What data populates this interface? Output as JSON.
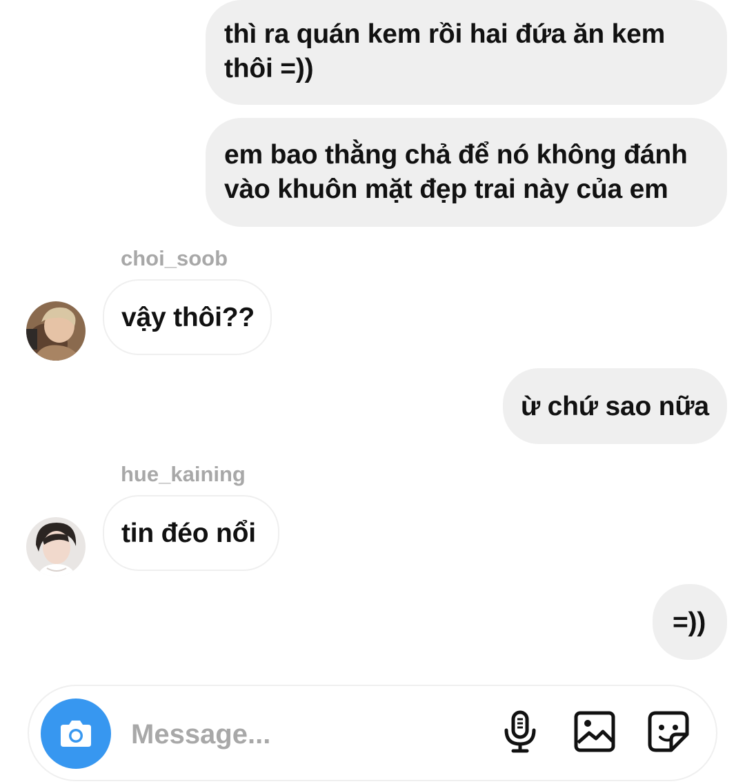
{
  "messages": [
    {
      "id": "m1",
      "direction": "outgoing",
      "lines": [
        "thì ra quán kem rồi hai đứa ăn kem",
        "thôi =))"
      ]
    },
    {
      "id": "m2",
      "direction": "outgoing",
      "lines": [
        "em bao thằng chả để nó không đánh",
        "vào khuôn mặt đẹp trai này của em"
      ]
    },
    {
      "id": "m3",
      "direction": "incoming",
      "sender": "choi_soob",
      "text": "vậy thôi??"
    },
    {
      "id": "m4",
      "direction": "outgoing",
      "text": "ừ chứ sao nữa"
    },
    {
      "id": "m5",
      "direction": "incoming",
      "sender": "hue_kaining",
      "text": "tin đéo nổi"
    },
    {
      "id": "m6",
      "direction": "outgoing",
      "text": "=))"
    }
  ],
  "composer": {
    "placeholder": "Message...",
    "icons": [
      "camera-icon",
      "microphone-icon",
      "gallery-icon",
      "sticker-icon"
    ]
  },
  "colors": {
    "outgoing_bubble": "#efefef",
    "incoming_border": "#efefef",
    "sender_text": "#a8a8a8",
    "camera_button": "#3797f0",
    "text": "#111111"
  }
}
